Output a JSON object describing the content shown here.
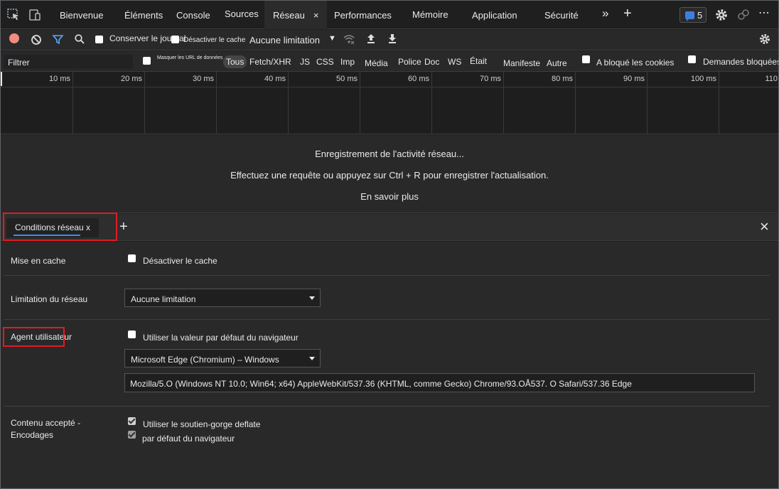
{
  "tabs": {
    "welcome": "Bienvenue",
    "elements": "Éléments",
    "console": "Console",
    "sources": "Sources",
    "network": "Réseau",
    "network_close": "×",
    "performance": "Performances",
    "memory": "Mémoire",
    "application": "Application",
    "security": "Sécurité",
    "more": "»",
    "add": "+",
    "issues_count": "5",
    "more_menu": "⋯",
    "close": "×"
  },
  "toolbar": {
    "preserve_log": "Conserver le journal",
    "disable_cache": "Désactiver le cache",
    "throttling": "Aucune limitation",
    "throttling_arrow": "▼"
  },
  "filter": {
    "placeholder": "Filtrer",
    "hide_data_urls": "Masquer les URL de données",
    "types": [
      "Tous",
      "Fetch/XHR",
      "JS",
      "CSS",
      "Imp",
      "Média",
      "Police",
      "Doc",
      "WS",
      "Était",
      "Manifeste",
      "Autre"
    ],
    "blocked_cookies": "A bloqué les cookies",
    "blocked_requests": "Demandes bloquées"
  },
  "timeline": {
    "ticks": [
      "10 ms",
      "20 ms",
      "30 ms",
      "40 ms",
      "50 ms",
      "60 ms",
      "70 ms",
      "80 ms",
      "90 ms",
      "100 ms",
      "110"
    ]
  },
  "message": {
    "line1": "Enregistrement de l'activité réseau...",
    "line2": "Effectuez une requête ou appuyez sur Ctrl + R pour enregistrer l'actualisation.",
    "line3": "En savoir plus"
  },
  "drawer": {
    "tab_label": "Conditions réseau x",
    "add": "+",
    "close": "×"
  },
  "conditions": {
    "caching_label": "Mise en cache",
    "caching_checkbox": "Désactiver le cache",
    "throttling_label": "Limitation du réseau",
    "throttling_value": "Aucune limitation",
    "ua_label": "Agent utilisateur",
    "ua_checkbox": "Utiliser la valeur par défaut du navigateur",
    "ua_select": "Microsoft Edge (Chromium) – Windows",
    "ua_string": "Mozilla/5.O (Windows NT 10.0; Win64; x64) AppleWebKit/537.36 (KHTML, comme Gecko) Chrome/93.OÅ537. O Safari/537.36 Edge",
    "encodings_label_1": "Contenu accepté -",
    "encodings_label_2": "Encodages",
    "encodings_check_1": "Utiliser le soutien-gorge deflate",
    "encodings_check_2": "par défaut du navigateur"
  },
  "colors": {
    "accent": "#3d8ef0",
    "record": "#f28b82",
    "highlight": "#e01b24",
    "background": "#292929"
  }
}
